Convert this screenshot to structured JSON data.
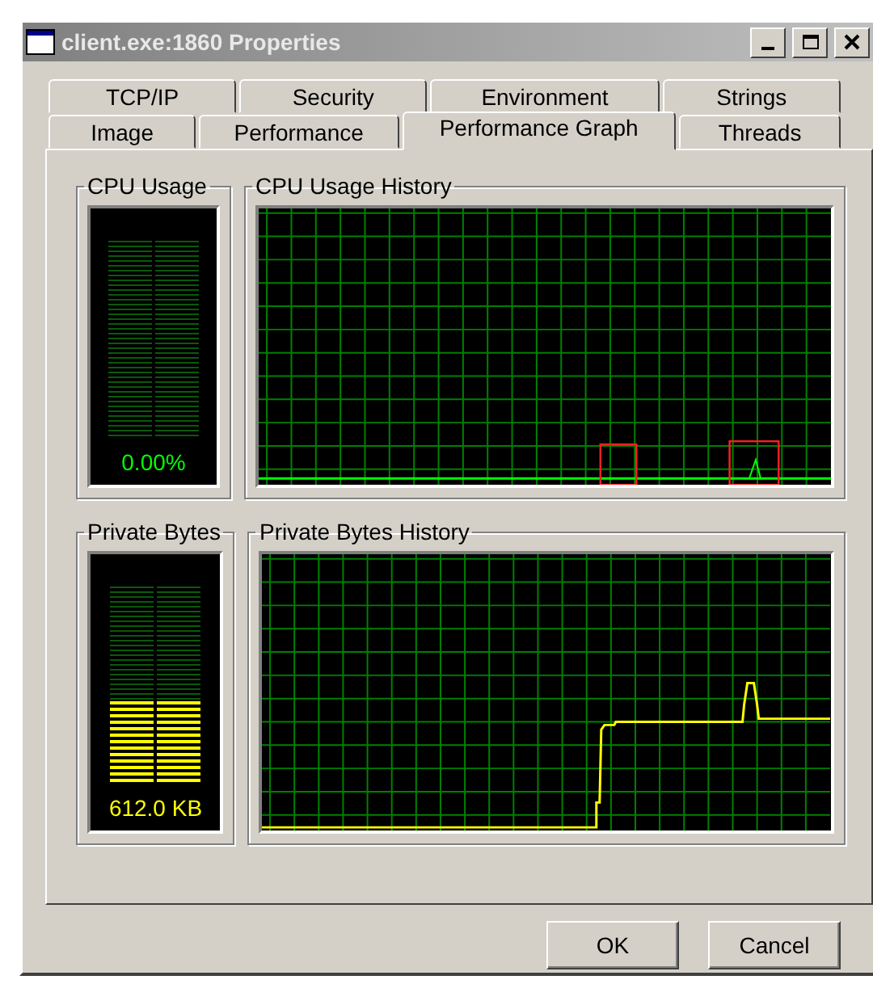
{
  "window": {
    "title": "client.exe:1860 Properties"
  },
  "tab_rows": [
    {
      "tabs": [
        {
          "label": "TCP/IP",
          "selected": false
        },
        {
          "label": "Security",
          "selected": false
        },
        {
          "label": "Environment",
          "selected": false
        },
        {
          "label": "Strings",
          "selected": false
        }
      ]
    },
    {
      "tabs": [
        {
          "label": "Image",
          "selected": false
        },
        {
          "label": "Performance",
          "selected": false
        },
        {
          "label": "Performance Graph",
          "selected": true
        },
        {
          "label": "Threads",
          "selected": false
        }
      ]
    }
  ],
  "sections": [
    {
      "meter": {
        "title": "CPU Usage",
        "kind": "cpu",
        "level": 0,
        "reading": "0.00%"
      },
      "history": {
        "title": "CPU Usage History",
        "kind": "cpu"
      }
    },
    {
      "meter": {
        "title": "Private Bytes",
        "kind": "memory",
        "level": 0.41,
        "reading": "612.0 KB"
      },
      "history": {
        "title": "Private Bytes History",
        "kind": "memory"
      }
    }
  ],
  "buttons": [
    "OK",
    "Cancel"
  ]
}
